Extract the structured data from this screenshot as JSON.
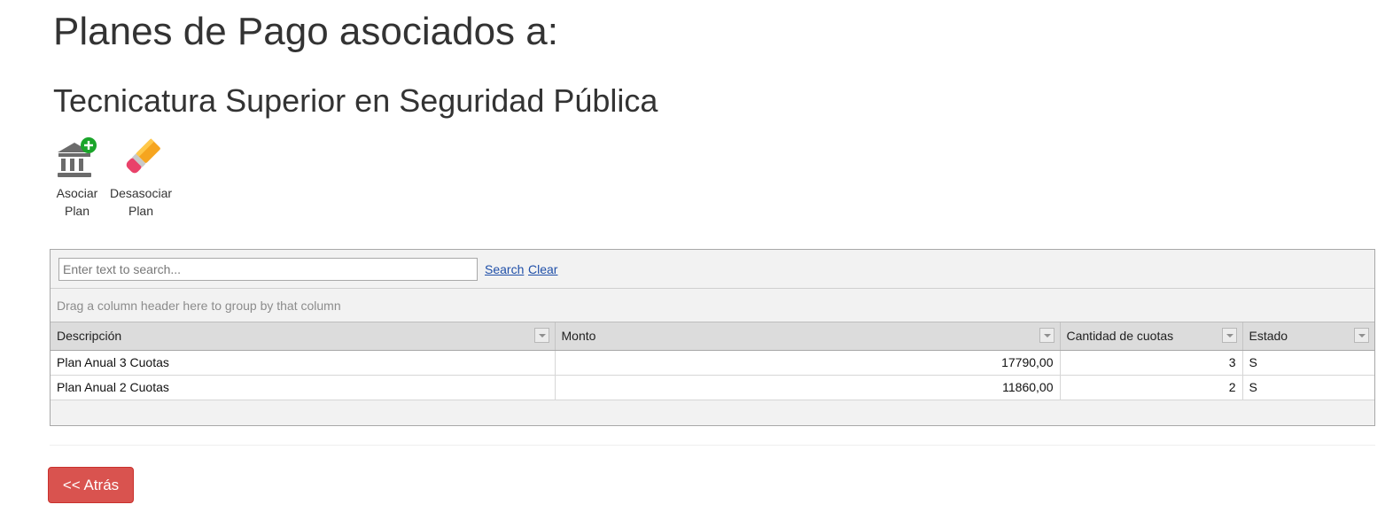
{
  "page": {
    "title": "Planes de Pago asociados a:",
    "subtitle": "Tecnicatura Superior en Seguridad Pública"
  },
  "toolbar": {
    "asociar": {
      "line1": "Asociar",
      "line2": "Plan",
      "icon": "bank-add-icon"
    },
    "desasociar": {
      "line1": "Desasociar",
      "line2": "Plan",
      "icon": "eraser-icon"
    }
  },
  "grid": {
    "search_placeholder": "Enter text to search...",
    "search_label": "Search",
    "clear_label": "Clear",
    "group_panel_text": "Drag a column header here to group by that column",
    "columns": [
      "Descripción",
      "Monto",
      "Cantidad de cuotas",
      "Estado"
    ],
    "rows": [
      {
        "descripcion": "Plan Anual 3 Cuotas",
        "monto": "17790,00",
        "cuotas": "3",
        "estado": "S"
      },
      {
        "descripcion": "Plan Anual 2 Cuotas",
        "monto": "11860,00",
        "cuotas": "2",
        "estado": "S"
      }
    ]
  },
  "back_button_label": "<< Atrás",
  "colors": {
    "danger": "#d9534f",
    "link": "#1f4fa8",
    "add_badge": "#1aa52a"
  }
}
